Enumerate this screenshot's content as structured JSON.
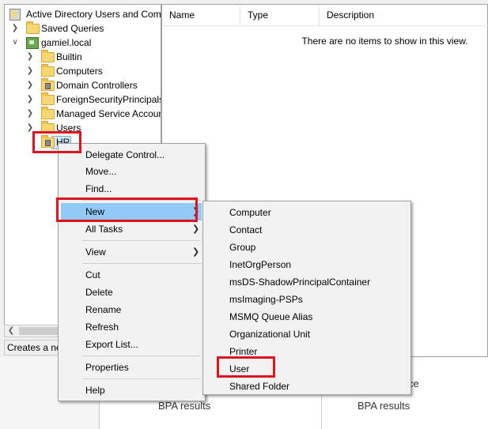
{
  "tree": {
    "root": "Active Directory Users and Com",
    "items": [
      {
        "label": "Saved Queries"
      },
      {
        "label": "gamiel.local"
      },
      {
        "label": "Builtin"
      },
      {
        "label": "Computers"
      },
      {
        "label": "Domain Controllers"
      },
      {
        "label": "ForeignSecurityPrincipals"
      },
      {
        "label": "Managed Service Accounts"
      },
      {
        "label": "Users"
      },
      {
        "label": "HR"
      }
    ]
  },
  "status_bar": {
    "text": "Creates a ne"
  },
  "list": {
    "columns": [
      "Name",
      "Type",
      "Description"
    ],
    "empty_message": "There are no items to show in this view."
  },
  "context_menu": {
    "items": [
      {
        "label": "Delegate Control..."
      },
      {
        "label": "Move..."
      },
      {
        "label": "Find..."
      },
      {
        "label": "New"
      },
      {
        "label": "All Tasks"
      },
      {
        "label": "View"
      },
      {
        "label": "Cut"
      },
      {
        "label": "Delete"
      },
      {
        "label": "Rename"
      },
      {
        "label": "Refresh"
      },
      {
        "label": "Export List..."
      },
      {
        "label": "Properties"
      },
      {
        "label": "Help"
      }
    ]
  },
  "new_submenu": {
    "items": [
      {
        "label": "Computer"
      },
      {
        "label": "Contact"
      },
      {
        "label": "Group"
      },
      {
        "label": "InetOrgPerson"
      },
      {
        "label": "msDS-ShadowPrincipalContainer"
      },
      {
        "label": "msImaging-PSPs"
      },
      {
        "label": "MSMQ Queue Alias"
      },
      {
        "label": "Organizational Unit"
      },
      {
        "label": "Printer"
      },
      {
        "label": "User"
      },
      {
        "label": "Shared Folder"
      }
    ]
  },
  "background": {
    "bpa_left": "BPA results",
    "bpa_right": "BPA results",
    "partial_text": "ce"
  },
  "colors": {
    "highlight": "#91c9f7",
    "annotation_red": "#e0141e"
  }
}
